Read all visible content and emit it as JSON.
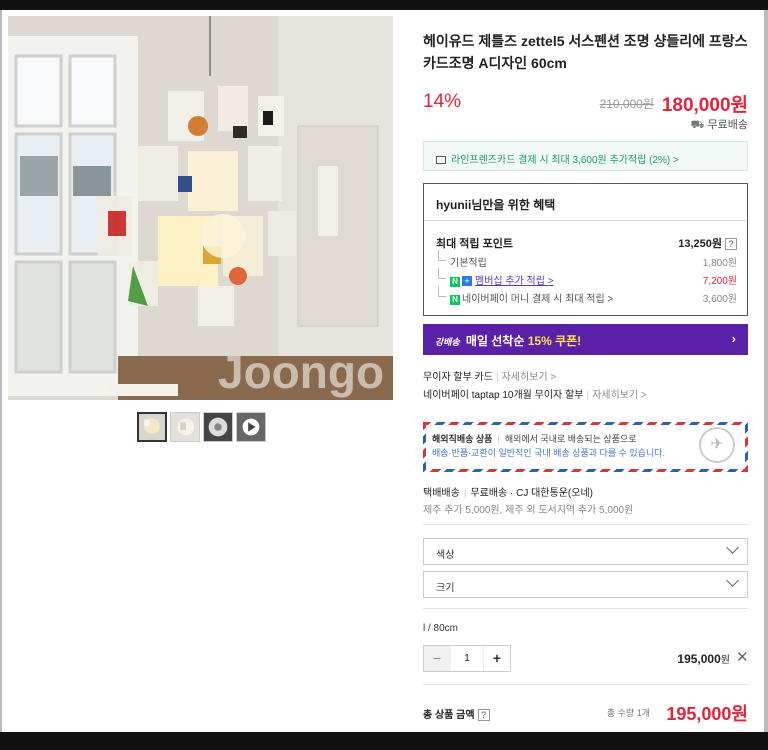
{
  "product": {
    "title": "헤이유드 제틀즈 zettel5 서스펜션 조명 샹들리에 프랑스 카드조명 A디자인 60cm",
    "discount": "14%",
    "original_price": "210,000원",
    "price": "180,000원",
    "shipping": "무료배송",
    "image_watermark": "Joongo"
  },
  "card_promo": "라인프렌즈카드 결제 시 최대 3,600원 추가적립 (2%) >",
  "benefits": {
    "title": "hyunii님만을 위한 혜택",
    "max_points_label": "최대 적립 포인트",
    "max_points_value": "13,250원",
    "qmark": "?",
    "rows": [
      {
        "label": "기본적립",
        "value": "1,800원"
      },
      {
        "badge": "N",
        "badge2": "+",
        "label": "멤버십 추가 적립 >",
        "value": "7,200원"
      },
      {
        "badge": "N",
        "label": "네이버페이 머니 결제 시 최대 적립 >",
        "value": "3,600원"
      }
    ]
  },
  "coupon": {
    "tag": "강배송",
    "text_pre": "매일 선착순 ",
    "highlight": "15% 쿠폰!",
    "arrow": "›"
  },
  "installments": [
    {
      "label": "무이자 할부 카드",
      "more": "자세히보기 >"
    },
    {
      "label": "네이버페이 taptap 10개월 무이자 할부",
      "more": "자세히보기 >"
    }
  ],
  "international": {
    "badge": "해외직배송 상품",
    "line1": "해외에서 국내로 배송되는 상품으로",
    "line2": "배송·반품·교환이 일반적인 국내 배송 상품과 다를 수 있습니다."
  },
  "delivery": {
    "type": "택배배송",
    "detail": "무료배송 · CJ 대한통운(오네)",
    "extra": "제주 추가 5,000원, 제주 외 도서지역 추가 5,000원"
  },
  "options": [
    {
      "label": "색상"
    },
    {
      "label": "크기"
    }
  ],
  "selected": {
    "option": "l / 80cm",
    "qty_minus": "−",
    "quantity": "1",
    "qty_plus": "+",
    "line_price": "195,000",
    "won": "원",
    "remove": "✕"
  },
  "total": {
    "label": "총 상품 금액",
    "qmark": "?",
    "qty_text": "총 수량 1개",
    "price": "195,000원"
  },
  "colors": {
    "sale_red": "#e0243a",
    "coupon_purple": "#5b20a8",
    "naver_green": "#03c75a",
    "card_green": "#1e9e62"
  }
}
